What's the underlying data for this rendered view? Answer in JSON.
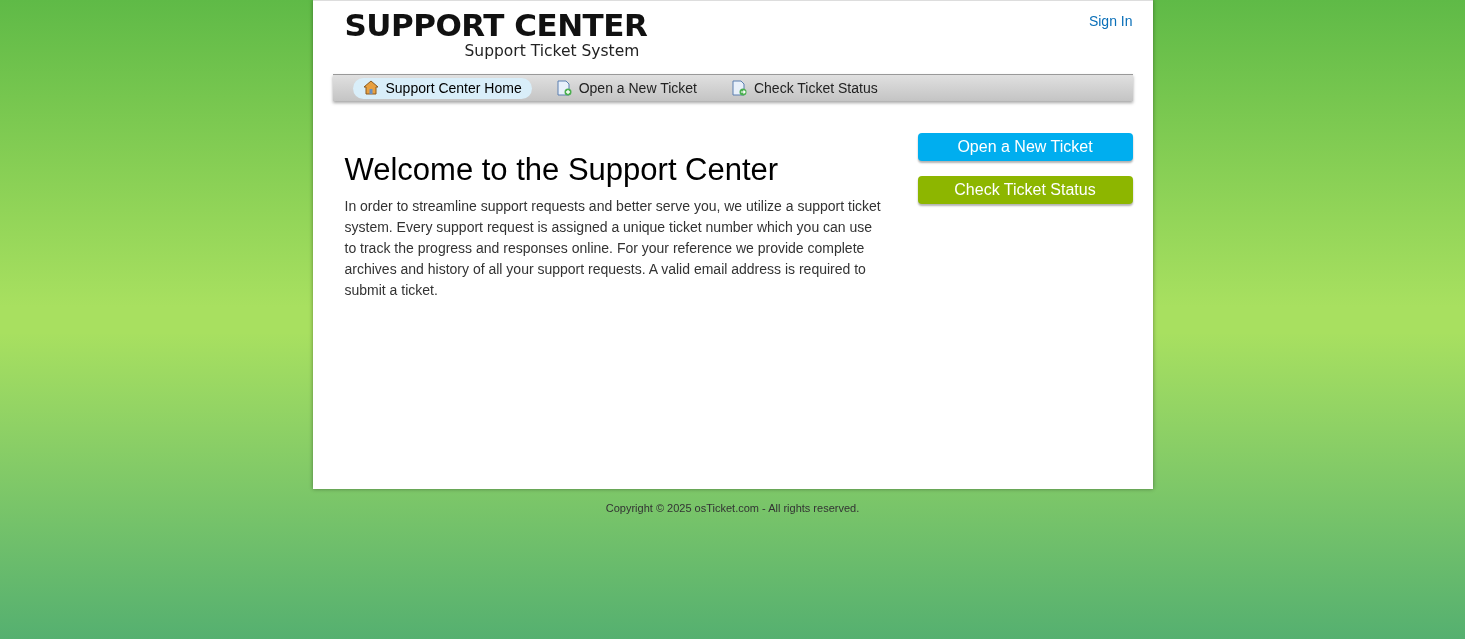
{
  "header": {
    "logo_title": "SUPPORT CENTER",
    "logo_subtitle": "Support Ticket System",
    "sign_in": "Sign In"
  },
  "nav": [
    {
      "label": "Support Center Home",
      "kind": "home",
      "selected": true
    },
    {
      "label": "Open a New Ticket",
      "kind": "new",
      "selected": false
    },
    {
      "label": "Check Ticket Status",
      "kind": "status",
      "selected": false
    }
  ],
  "welcome": {
    "title": "Welcome to the Support Center",
    "body": "In order to streamline support requests and better serve you, we utilize a support ticket system. Every support request is assigned a unique ticket number which you can use to track the progress and responses online. For your reference we provide complete archives and history of all your support requests. A valid email address is required to submit a ticket."
  },
  "side_buttons": [
    {
      "label": "Open a New Ticket",
      "color": "#00aeef"
    },
    {
      "label": "Check Ticket Status",
      "color": "#8db600"
    }
  ],
  "footer": "Copyright © 2025 osTicket.com - All rights reserved."
}
